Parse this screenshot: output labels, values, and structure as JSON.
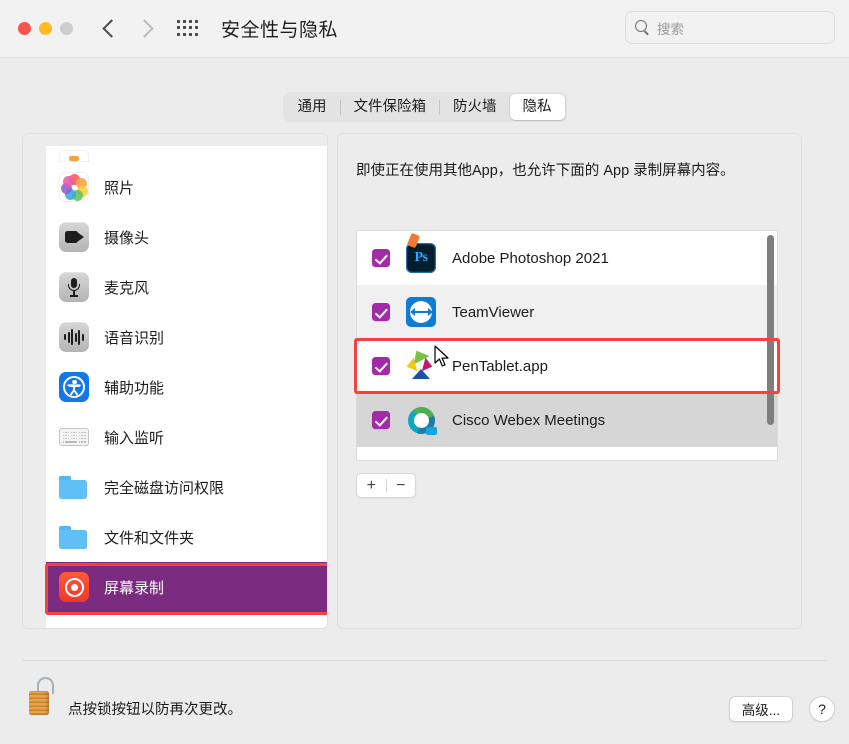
{
  "titlebar": {
    "title": "安全性与隐私",
    "back_icon": "chevron-left-icon",
    "forward_icon": "chevron-right-icon",
    "grid_icon": "show-all-grid-icon",
    "search": {
      "placeholder": "搜索",
      "icon": "search-icon",
      "value": ""
    }
  },
  "tabs": [
    {
      "label": "通用",
      "selected": false
    },
    {
      "label": "文件保险箱",
      "selected": false
    },
    {
      "label": "防火墙",
      "selected": false
    },
    {
      "label": "隐私",
      "selected": true
    }
  ],
  "sidebar": {
    "items": [
      {
        "label": "",
        "icon": "partial-app-icon",
        "selected": false,
        "partial": true
      },
      {
        "label": "照片",
        "icon": "photos-icon",
        "selected": false
      },
      {
        "label": "摄像头",
        "icon": "camera-icon",
        "selected": false
      },
      {
        "label": "麦克风",
        "icon": "microphone-icon",
        "selected": false
      },
      {
        "label": "语音识别",
        "icon": "speech-recognition-icon",
        "selected": false
      },
      {
        "label": "辅助功能",
        "icon": "accessibility-icon",
        "selected": false
      },
      {
        "label": "输入监听",
        "icon": "input-monitoring-keyboard-icon",
        "selected": false
      },
      {
        "label": "完全磁盘访问权限",
        "icon": "folder-icon",
        "selected": false
      },
      {
        "label": "文件和文件夹",
        "icon": "folder-icon",
        "selected": false
      },
      {
        "label": "屏幕录制",
        "icon": "screen-recording-icon",
        "selected": true
      }
    ]
  },
  "main": {
    "description": "即使正在使用其他App，也允许下面的 App 录制屏幕内容。",
    "apps": [
      {
        "name": "Adobe Photoshop 2021",
        "checked": true,
        "icon": "photoshop-icon"
      },
      {
        "name": "TeamViewer",
        "checked": true,
        "icon": "teamviewer-icon"
      },
      {
        "name": "PenTablet.app",
        "checked": true,
        "icon": "pentablet-icon",
        "highlighted": true
      },
      {
        "name": "Cisco Webex Meetings",
        "checked": true,
        "icon": "webex-icon"
      }
    ],
    "add_button": "+",
    "remove_button": "−"
  },
  "bottom": {
    "lock_icon": "unlocked-padlock-icon",
    "lock_text": "点按锁按钮以防再次更改。",
    "advanced_button": "高级...",
    "help_button": "?"
  },
  "colors": {
    "checkbox": "#a32ba8",
    "selected_row": "#7b2b80",
    "annotation": "#f5423c",
    "window_bg": "#ececec"
  }
}
